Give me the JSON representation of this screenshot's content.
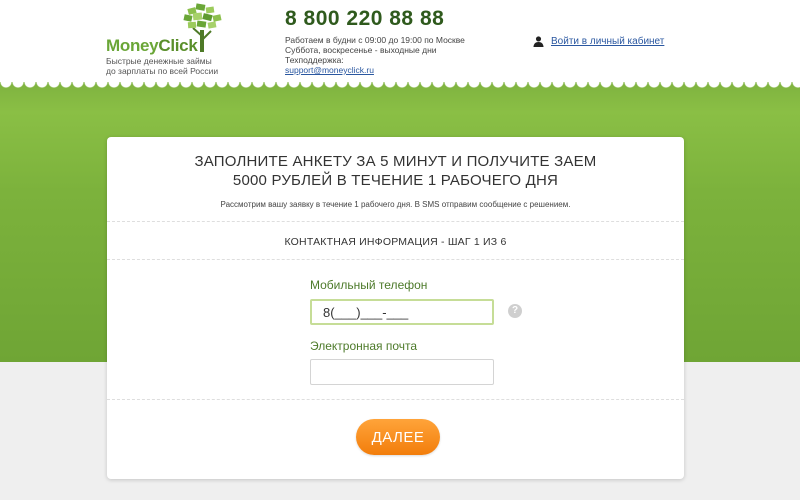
{
  "header": {
    "logo": {
      "word_money": "Money",
      "word_click": "Click",
      "tagline_line1": "Быстрые денежные займы",
      "tagline_line2": "до зарплаты по всей России"
    },
    "phone": "8 800 220 88 88",
    "hours_line1": "Работаем в будни с 09:00 до 19:00 по Москве",
    "hours_line2": "Суббота, воскресенье - выходные дни",
    "support_label": "Техподдержка:",
    "support_email": "support@moneyclick.ru",
    "cabinet_link": "Войти в личный кабинет",
    "cabinet_icon": "user-icon"
  },
  "card": {
    "title_line1": "ЗАПОЛНИТЕ АНКЕТУ ЗА 5 МИНУТ И ПОЛУЧИТЕ ЗАЕМ",
    "title_line2": "5000 РУБЛЕЙ В ТЕЧЕНИЕ 1 РАБОЧЕГО ДНЯ",
    "subtitle": "Рассмотрим вашу заявку в течение 1 рабочего дня. В SMS отправим сообщение с решением.",
    "step": "КОНТАКТНАЯ ИНФОРМАЦИЯ - ШАГ 1 ИЗ 6",
    "phone_field": {
      "label": "Мобильный телефон",
      "value": "8(___)___-___",
      "help": "?"
    },
    "email_field": {
      "label": "Электронная почта",
      "value": ""
    },
    "next_button": "ДАЛЕЕ"
  },
  "colors": {
    "brand_green": "#6aa637",
    "dark_green": "#2f5a1d",
    "band_green": "#7fb33f",
    "link_blue": "#2a57a0",
    "button_orange": "#f5891a"
  }
}
